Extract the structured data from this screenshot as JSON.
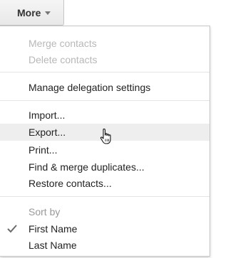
{
  "button": {
    "label": "More",
    "icon": "caret-down-icon"
  },
  "menu": {
    "items": [
      {
        "label": "Merge contacts",
        "enabled": false
      },
      {
        "label": "Delete contacts",
        "enabled": false
      },
      {
        "label": "Manage delegation settings",
        "enabled": true
      },
      {
        "label": "Import...",
        "enabled": true
      },
      {
        "label": "Export...",
        "enabled": true,
        "hovered": true
      },
      {
        "label": "Print...",
        "enabled": true
      },
      {
        "label": "Find & merge duplicates...",
        "enabled": true
      },
      {
        "label": "Restore contacts...",
        "enabled": true
      }
    ],
    "sort": {
      "header": "Sort by",
      "options": [
        {
          "label": "First Name",
          "checked": true
        },
        {
          "label": "Last Name",
          "checked": false
        }
      ]
    }
  },
  "cursor": "hand-pointer-icon",
  "colors": {
    "disabled_text": "#b8b8b8",
    "hover_bg": "#eeeeee",
    "header_text": "#999999"
  }
}
